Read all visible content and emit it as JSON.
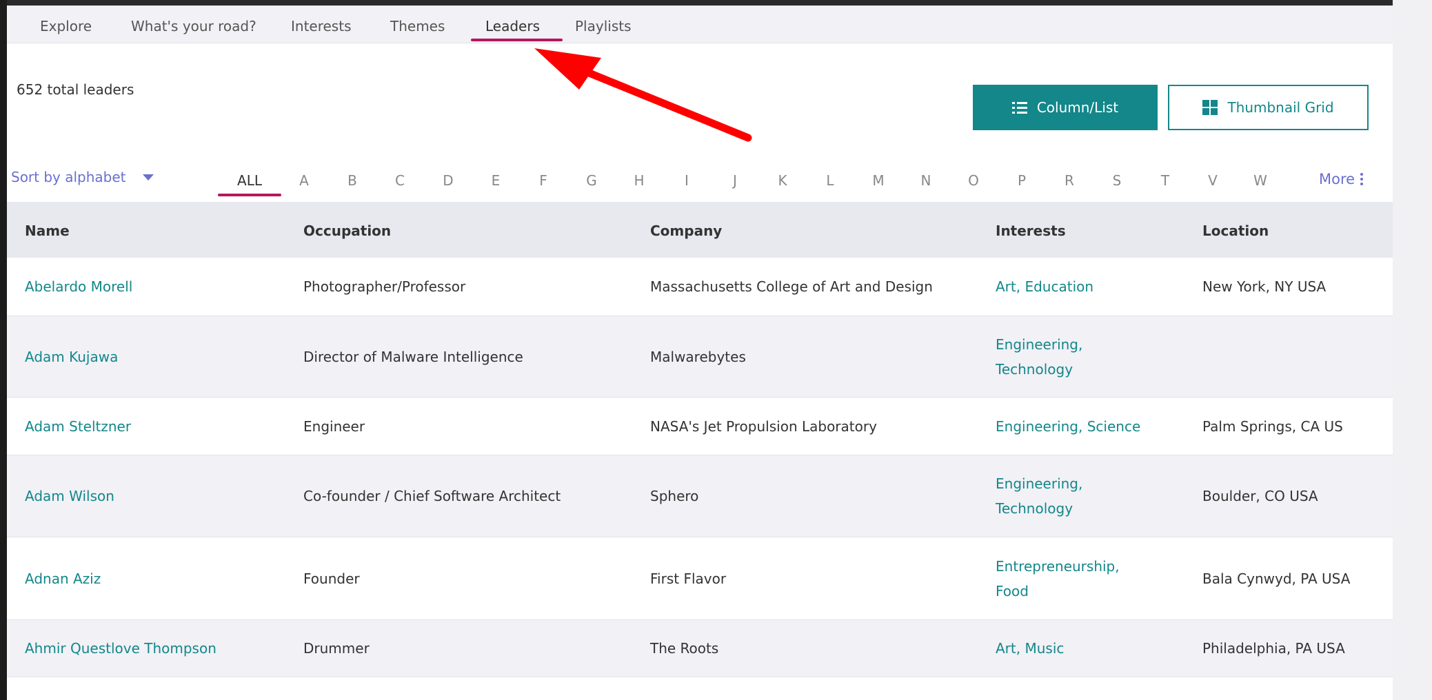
{
  "nav": {
    "tabs": [
      {
        "label": "Explore"
      },
      {
        "label": "What's your road?"
      },
      {
        "label": "Interests"
      },
      {
        "label": "Themes"
      },
      {
        "label": "Leaders"
      },
      {
        "label": "Playlists"
      }
    ],
    "active_tab": "Leaders"
  },
  "summary": {
    "total_text": "652 total leaders"
  },
  "view_toggle": {
    "column_list_label": "Column/List",
    "thumbnail_grid_label": "Thumbnail Grid"
  },
  "filter": {
    "sort_label": "Sort by alphabet",
    "letters": [
      "ALL",
      "A",
      "B",
      "C",
      "D",
      "E",
      "F",
      "G",
      "H",
      "I",
      "J",
      "K",
      "L",
      "M",
      "N",
      "O",
      "P",
      "R",
      "S",
      "T",
      "V",
      "W"
    ],
    "active_letter": "ALL",
    "more_label": "More"
  },
  "table": {
    "headers": {
      "name": "Name",
      "occupation": "Occupation",
      "company": "Company",
      "interests": "Interests",
      "location": "Location"
    },
    "rows": [
      {
        "name": "Abelardo Morell",
        "occupation": "Photographer/Professor",
        "company": "Massachusetts College of Art and Design",
        "interests": [
          "Art",
          "Education"
        ],
        "location": "New York, NY USA"
      },
      {
        "name": "Adam Kujawa",
        "occupation": "Director of Malware Intelligence",
        "company": "Malwarebytes",
        "interests": [
          "Engineering",
          "Technology"
        ],
        "location": ""
      },
      {
        "name": "Adam Steltzner",
        "occupation": "Engineer",
        "company": "NASA's Jet Propulsion Laboratory",
        "interests": [
          "Engineering",
          "Science"
        ],
        "location": "Palm Springs, CA US"
      },
      {
        "name": "Adam Wilson",
        "occupation": "Co-founder / Chief Software Architect",
        "company": "Sphero",
        "interests": [
          "Engineering",
          "Technology"
        ],
        "location": "Boulder, CO USA"
      },
      {
        "name": "Adnan Aziz",
        "occupation": "Founder",
        "company": "First Flavor",
        "interests": [
          "Entrepreneurship",
          "Food"
        ],
        "location": "Bala Cynwyd, PA USA"
      },
      {
        "name": "Ahmir Questlove Thompson",
        "occupation": "Drummer",
        "company": "The Roots",
        "interests": [
          "Art",
          "Music"
        ],
        "location": "Philadelphia, PA USA"
      }
    ]
  },
  "colors": {
    "accent_teal": "#13878a",
    "active_underline": "#b5175e",
    "link_purple": "#6a6fd0",
    "annotation_arrow": "#ff0000"
  },
  "icons": {
    "column_list": "list-icon",
    "thumbnail_grid": "grid-icon",
    "sort": "caret-down-icon",
    "more": "vertical-dots-icon",
    "annotation": "red-arrow-icon"
  }
}
